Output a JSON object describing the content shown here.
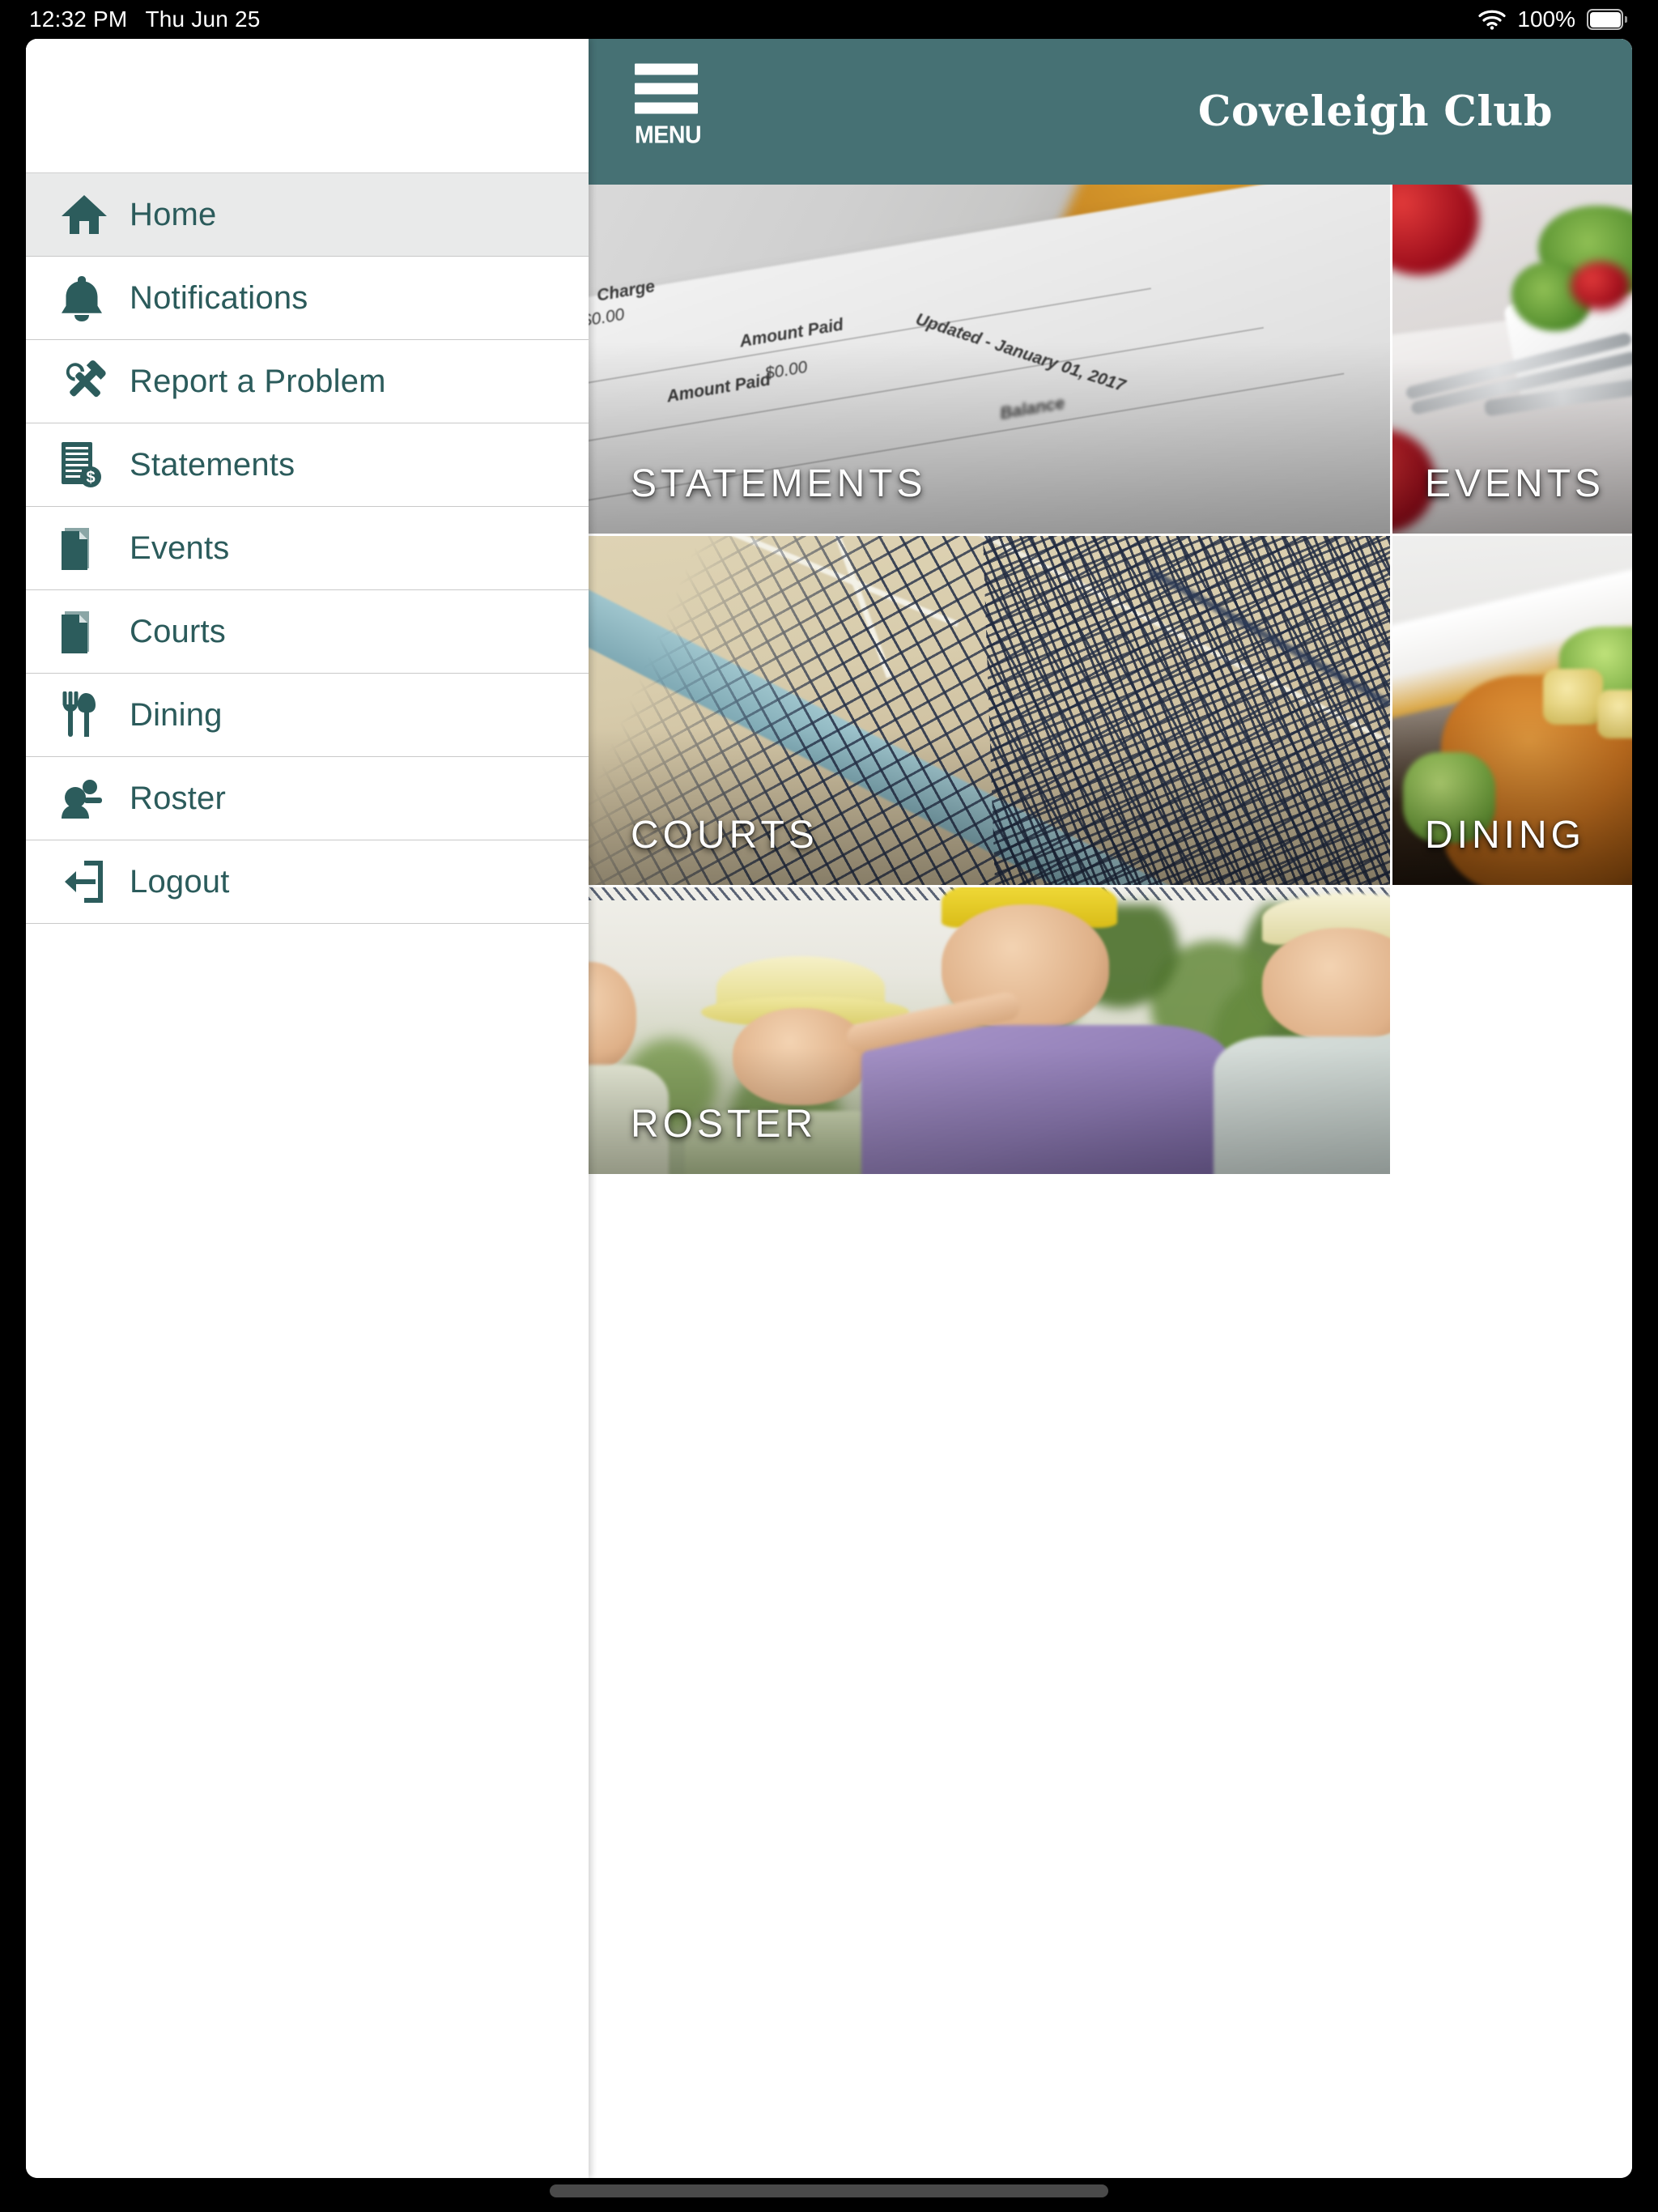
{
  "status_bar": {
    "time": "12:32 PM",
    "date": "Thu Jun 25",
    "battery_percent": "100%",
    "wifi_icon": "wifi-icon",
    "battery_icon": "battery-full-icon"
  },
  "sidebar": {
    "items": [
      {
        "label": "Home",
        "icon": "home-icon",
        "active": true
      },
      {
        "label": "Notifications",
        "icon": "bell-icon",
        "active": false
      },
      {
        "label": "Report a Problem",
        "icon": "tools-icon",
        "active": false
      },
      {
        "label": "Statements",
        "icon": "invoice-dollar-icon",
        "active": false
      },
      {
        "label": "Events",
        "icon": "document-icon",
        "active": false
      },
      {
        "label": "Courts",
        "icon": "document-icon",
        "active": false
      },
      {
        "label": "Dining",
        "icon": "fork-knife-icon",
        "active": false
      },
      {
        "label": "Roster",
        "icon": "people-icon",
        "active": false
      },
      {
        "label": "Logout",
        "icon": "logout-icon",
        "active": false
      }
    ]
  },
  "header": {
    "menu_button_label": "MENU",
    "menu_icon": "hamburger-icon",
    "title": "Coveleigh Club",
    "background_color": "#467174"
  },
  "tiles": [
    {
      "caption": "STATEMENTS",
      "image": "financial-statement-photo"
    },
    {
      "caption": "EVENTS",
      "image": "table-setting-roses-photo"
    },
    {
      "caption": "COURTS",
      "image": "tennis-net-photo"
    },
    {
      "caption": "DINING",
      "image": "plated-crab-cake-photo"
    },
    {
      "caption": "ROSTER",
      "image": "smiling-golfers-photo"
    }
  ],
  "tile_artwork_text": {
    "statements": {
      "charge": "Charge",
      "amount_paid_1": "Amount Paid",
      "amount_value": "$0.00",
      "updated": "Updated - January 01, 2017",
      "amount_paid_2": "Amount Paid",
      "balance": "Balance"
    }
  },
  "colors": {
    "brand_teal": "#467174",
    "menu_text_teal": "#2b5b5b",
    "menu_active_bg": "#e9eaea",
    "status_bar_bg": "#000000"
  }
}
